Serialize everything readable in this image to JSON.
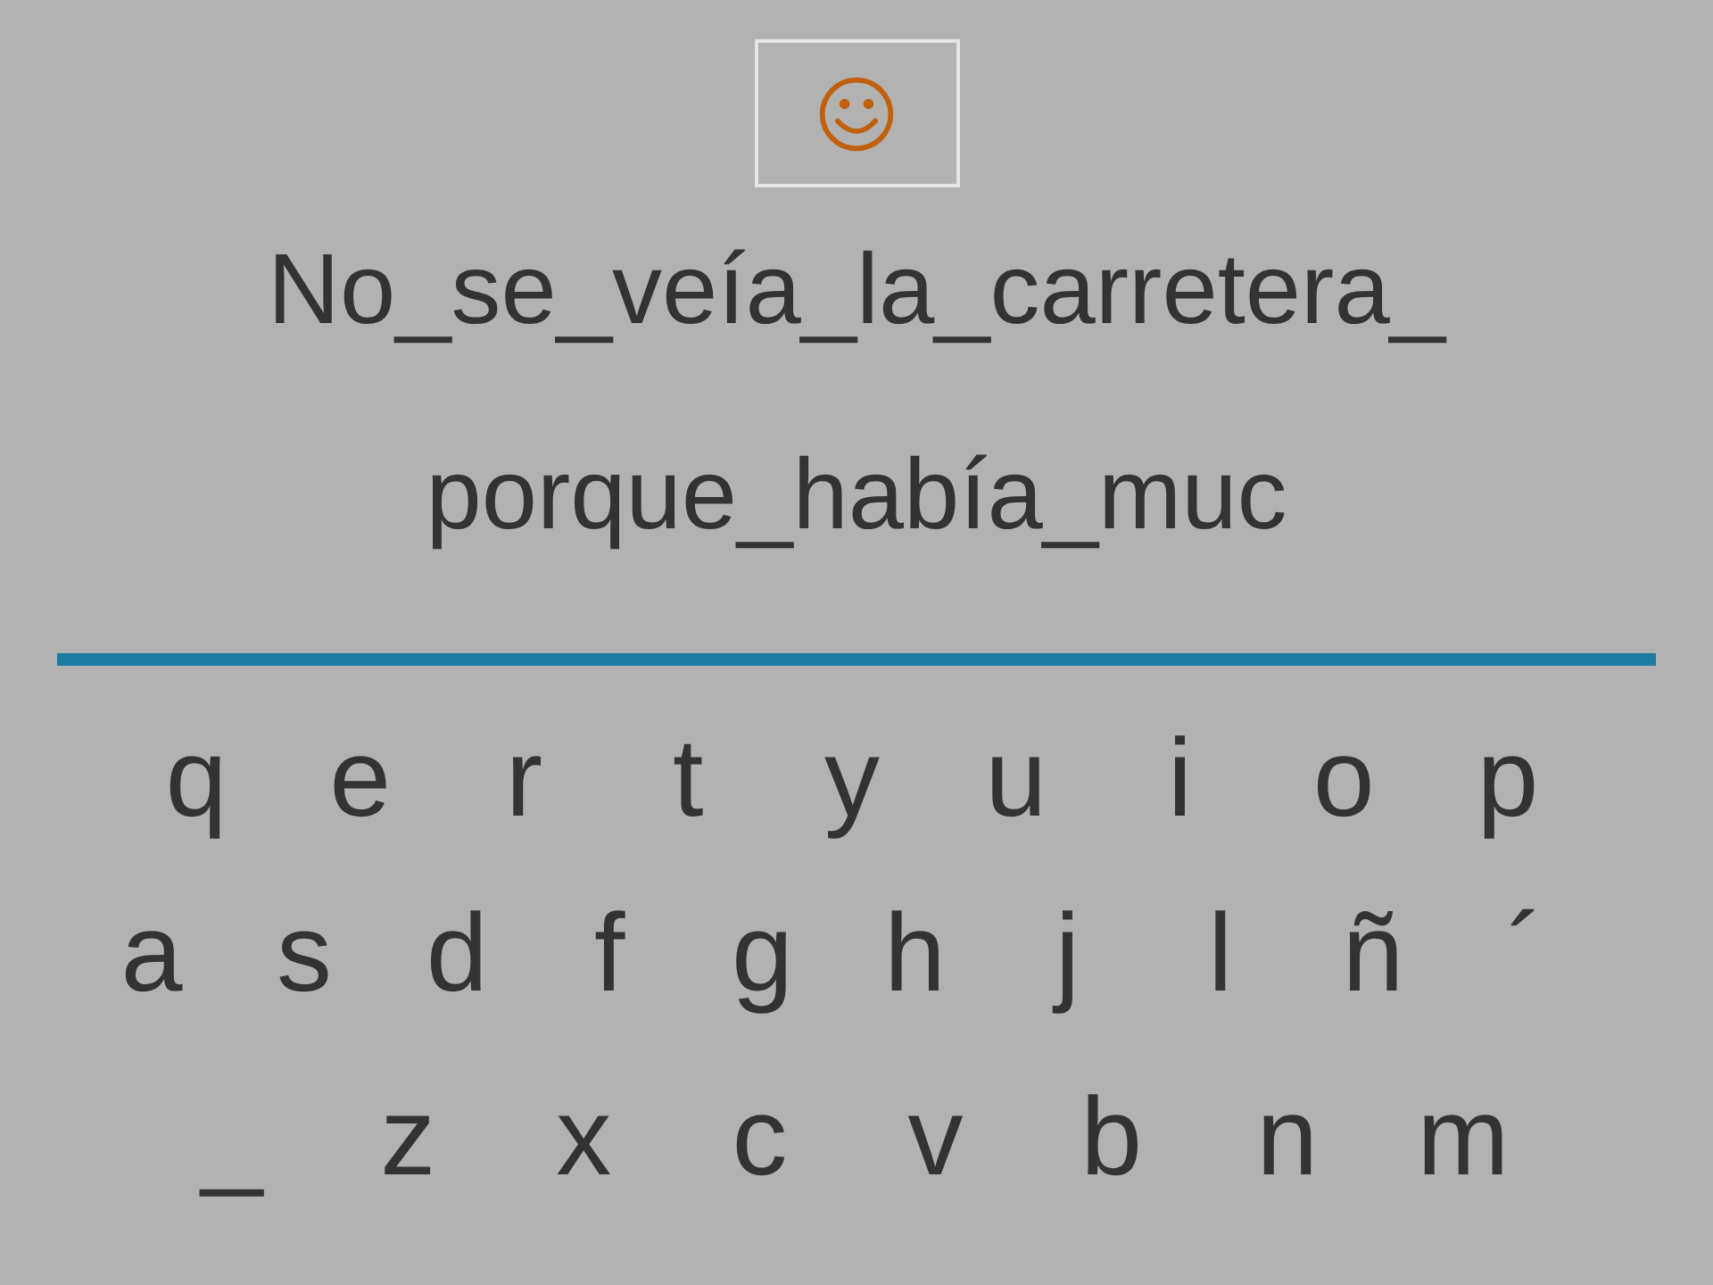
{
  "sentence_lines": [
    "No_se_veía_la_carretera_",
    "porque_había_muc"
  ],
  "keyboard_rows": [
    [
      "q",
      "e",
      "r",
      "t",
      "y",
      "u",
      "i",
      "o",
      "p"
    ],
    [
      "a",
      "s",
      "d",
      "f",
      "g",
      "h",
      "j",
      "l",
      "ñ",
      "´"
    ],
    [
      "_",
      "z",
      "x",
      "c",
      "v",
      "b",
      "n",
      "m"
    ]
  ]
}
